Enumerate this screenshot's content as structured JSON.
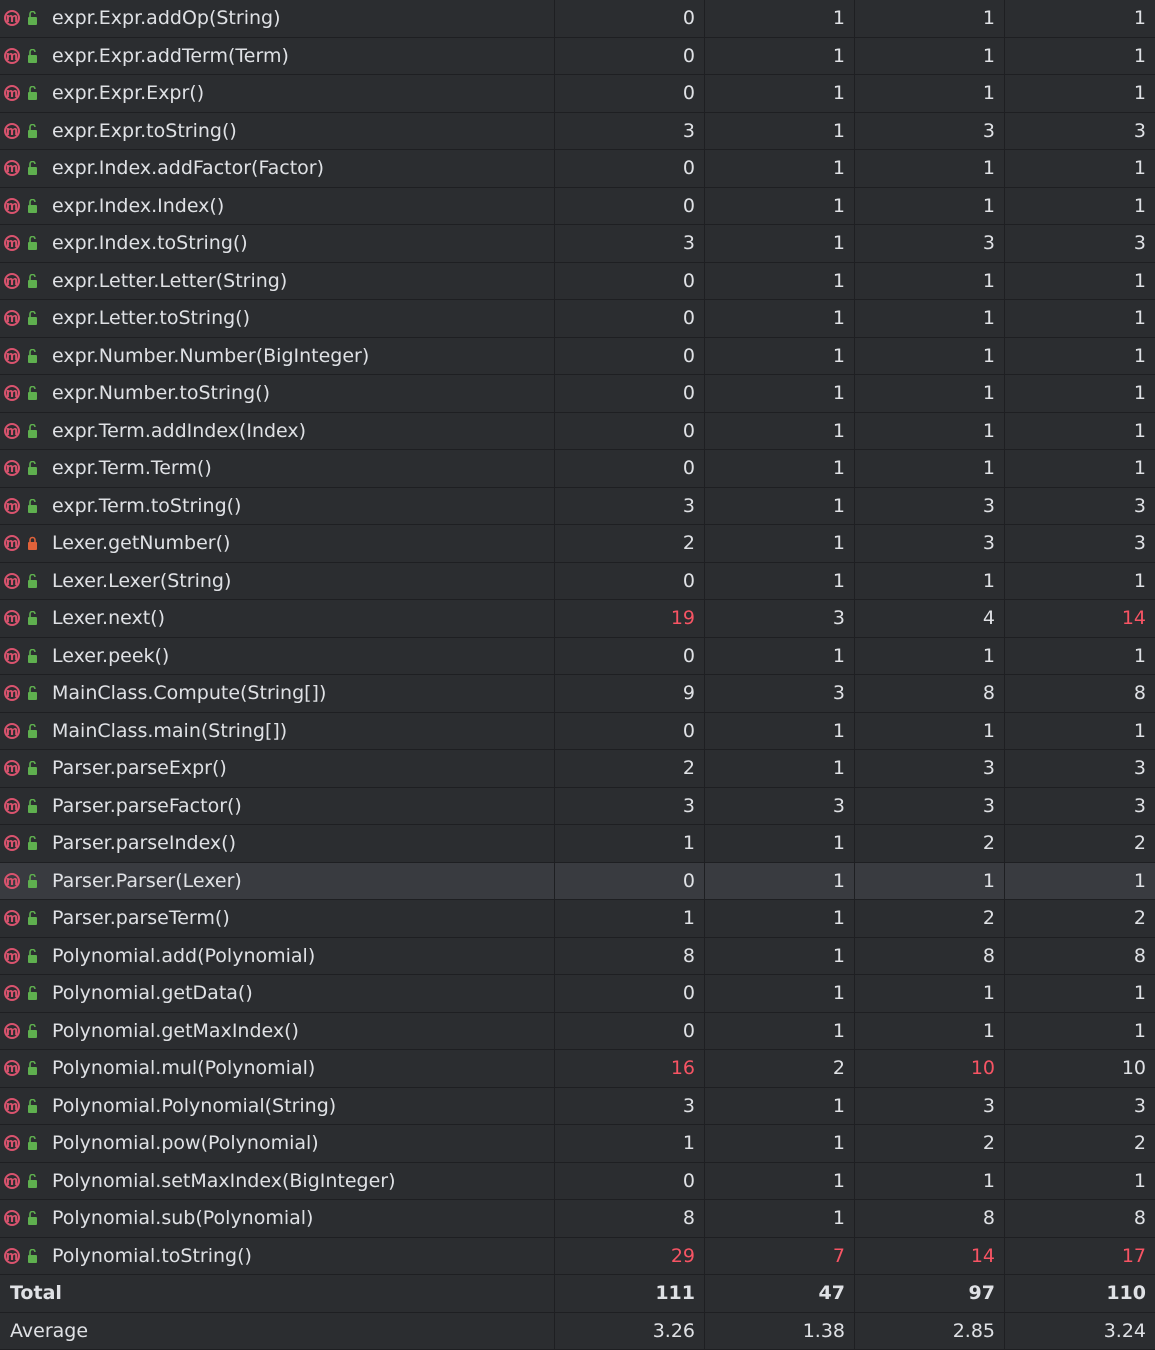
{
  "colors": {
    "background": "#2b2d30",
    "selected_row": "#393b40",
    "warning_red": "#f75464",
    "method_icon": "#d9536e",
    "public_icon": "#5fb04f",
    "private_icon": "#e0623a"
  },
  "icons": {
    "method": "method-m-icon",
    "public": "public-lock-open-icon",
    "private": "private-lock-icon"
  },
  "rows": [
    {
      "name": "expr.Expr.addOp(String)",
      "icon_letter": "m",
      "vis": "public",
      "v": [
        "0",
        "1",
        "1",
        "1"
      ],
      "red": [
        false,
        false,
        false,
        false
      ]
    },
    {
      "name": "expr.Expr.addTerm(Term)",
      "icon_letter": "m",
      "vis": "public",
      "v": [
        "0",
        "1",
        "1",
        "1"
      ],
      "red": [
        false,
        false,
        false,
        false
      ]
    },
    {
      "name": "expr.Expr.Expr()",
      "icon_letter": "m",
      "vis": "public",
      "v": [
        "0",
        "1",
        "1",
        "1"
      ],
      "red": [
        false,
        false,
        false,
        false
      ]
    },
    {
      "name": "expr.Expr.toString()",
      "icon_letter": "m",
      "vis": "public",
      "v": [
        "3",
        "1",
        "3",
        "3"
      ],
      "red": [
        false,
        false,
        false,
        false
      ]
    },
    {
      "name": "expr.Index.addFactor(Factor)",
      "icon_letter": "m",
      "vis": "public",
      "v": [
        "0",
        "1",
        "1",
        "1"
      ],
      "red": [
        false,
        false,
        false,
        false
      ]
    },
    {
      "name": "expr.Index.Index()",
      "icon_letter": "m",
      "vis": "public",
      "v": [
        "0",
        "1",
        "1",
        "1"
      ],
      "red": [
        false,
        false,
        false,
        false
      ]
    },
    {
      "name": "expr.Index.toString()",
      "icon_letter": "m",
      "vis": "public",
      "v": [
        "3",
        "1",
        "3",
        "3"
      ],
      "red": [
        false,
        false,
        false,
        false
      ]
    },
    {
      "name": "expr.Letter.Letter(String)",
      "icon_letter": "m",
      "vis": "public",
      "v": [
        "0",
        "1",
        "1",
        "1"
      ],
      "red": [
        false,
        false,
        false,
        false
      ]
    },
    {
      "name": "expr.Letter.toString()",
      "icon_letter": "m",
      "vis": "public",
      "v": [
        "0",
        "1",
        "1",
        "1"
      ],
      "red": [
        false,
        false,
        false,
        false
      ]
    },
    {
      "name": "expr.Number.Number(BigInteger)",
      "icon_letter": "m",
      "vis": "public",
      "v": [
        "0",
        "1",
        "1",
        "1"
      ],
      "red": [
        false,
        false,
        false,
        false
      ]
    },
    {
      "name": "expr.Number.toString()",
      "icon_letter": "m",
      "vis": "public",
      "v": [
        "0",
        "1",
        "1",
        "1"
      ],
      "red": [
        false,
        false,
        false,
        false
      ]
    },
    {
      "name": "expr.Term.addIndex(Index)",
      "icon_letter": "m",
      "vis": "public",
      "v": [
        "0",
        "1",
        "1",
        "1"
      ],
      "red": [
        false,
        false,
        false,
        false
      ]
    },
    {
      "name": "expr.Term.Term()",
      "icon_letter": "m",
      "vis": "public",
      "v": [
        "0",
        "1",
        "1",
        "1"
      ],
      "red": [
        false,
        false,
        false,
        false
      ]
    },
    {
      "name": "expr.Term.toString()",
      "icon_letter": "m",
      "vis": "public",
      "v": [
        "3",
        "1",
        "3",
        "3"
      ],
      "red": [
        false,
        false,
        false,
        false
      ]
    },
    {
      "name": "Lexer.getNumber()",
      "icon_letter": "m",
      "vis": "private",
      "v": [
        "2",
        "1",
        "3",
        "3"
      ],
      "red": [
        false,
        false,
        false,
        false
      ]
    },
    {
      "name": "Lexer.Lexer(String)",
      "icon_letter": "m",
      "vis": "public",
      "v": [
        "0",
        "1",
        "1",
        "1"
      ],
      "red": [
        false,
        false,
        false,
        false
      ]
    },
    {
      "name": "Lexer.next()",
      "icon_letter": "m",
      "vis": "public",
      "v": [
        "19",
        "3",
        "4",
        "14"
      ],
      "red": [
        true,
        false,
        false,
        true
      ]
    },
    {
      "name": "Lexer.peek()",
      "icon_letter": "m",
      "vis": "public",
      "v": [
        "0",
        "1",
        "1",
        "1"
      ],
      "red": [
        false,
        false,
        false,
        false
      ]
    },
    {
      "name": "MainClass.Compute(String[])",
      "icon_letter": "m",
      "vis": "public",
      "v": [
        "9",
        "3",
        "8",
        "8"
      ],
      "red": [
        false,
        false,
        false,
        false
      ]
    },
    {
      "name": "MainClass.main(String[])",
      "icon_letter": "m",
      "vis": "public",
      "v": [
        "0",
        "1",
        "1",
        "1"
      ],
      "red": [
        false,
        false,
        false,
        false
      ]
    },
    {
      "name": "Parser.parseExpr()",
      "icon_letter": "m",
      "vis": "public",
      "v": [
        "2",
        "1",
        "3",
        "3"
      ],
      "red": [
        false,
        false,
        false,
        false
      ]
    },
    {
      "name": "Parser.parseFactor()",
      "icon_letter": "m",
      "vis": "public",
      "v": [
        "3",
        "3",
        "3",
        "3"
      ],
      "red": [
        false,
        false,
        false,
        false
      ]
    },
    {
      "name": "Parser.parseIndex()",
      "icon_letter": "m",
      "vis": "public",
      "v": [
        "1",
        "1",
        "2",
        "2"
      ],
      "red": [
        false,
        false,
        false,
        false
      ]
    },
    {
      "name": "Parser.Parser(Lexer)",
      "icon_letter": "m",
      "vis": "public",
      "v": [
        "0",
        "1",
        "1",
        "1"
      ],
      "red": [
        false,
        false,
        false,
        false
      ],
      "selected": true
    },
    {
      "name": "Parser.parseTerm()",
      "icon_letter": "m",
      "vis": "public",
      "v": [
        "1",
        "1",
        "2",
        "2"
      ],
      "red": [
        false,
        false,
        false,
        false
      ]
    },
    {
      "name": "Polynomial.add(Polynomial)",
      "icon_letter": "m",
      "vis": "public",
      "v": [
        "8",
        "1",
        "8",
        "8"
      ],
      "red": [
        false,
        false,
        false,
        false
      ]
    },
    {
      "name": "Polynomial.getData()",
      "icon_letter": "m",
      "vis": "public",
      "v": [
        "0",
        "1",
        "1",
        "1"
      ],
      "red": [
        false,
        false,
        false,
        false
      ]
    },
    {
      "name": "Polynomial.getMaxIndex()",
      "icon_letter": "m",
      "vis": "public",
      "v": [
        "0",
        "1",
        "1",
        "1"
      ],
      "red": [
        false,
        false,
        false,
        false
      ]
    },
    {
      "name": "Polynomial.mul(Polynomial)",
      "icon_letter": "m",
      "vis": "public",
      "v": [
        "16",
        "2",
        "10",
        "10"
      ],
      "red": [
        true,
        false,
        true,
        false
      ]
    },
    {
      "name": "Polynomial.Polynomial(String)",
      "icon_letter": "m",
      "vis": "public",
      "v": [
        "3",
        "1",
        "3",
        "3"
      ],
      "red": [
        false,
        false,
        false,
        false
      ]
    },
    {
      "name": "Polynomial.pow(Polynomial)",
      "icon_letter": "m",
      "vis": "public",
      "v": [
        "1",
        "1",
        "2",
        "2"
      ],
      "red": [
        false,
        false,
        false,
        false
      ]
    },
    {
      "name": "Polynomial.setMaxIndex(BigInteger)",
      "icon_letter": "m",
      "vis": "public",
      "v": [
        "0",
        "1",
        "1",
        "1"
      ],
      "red": [
        false,
        false,
        false,
        false
      ]
    },
    {
      "name": "Polynomial.sub(Polynomial)",
      "icon_letter": "m",
      "vis": "public",
      "v": [
        "8",
        "1",
        "8",
        "8"
      ],
      "red": [
        false,
        false,
        false,
        false
      ]
    },
    {
      "name": "Polynomial.toString()",
      "icon_letter": "m",
      "vis": "public",
      "v": [
        "29",
        "7",
        "14",
        "17"
      ],
      "red": [
        true,
        true,
        true,
        true
      ]
    }
  ],
  "total": {
    "label": "Total",
    "v": [
      "111",
      "47",
      "97",
      "110"
    ]
  },
  "average": {
    "label": "Average",
    "v": [
      "3.26",
      "1.38",
      "2.85",
      "3.24"
    ]
  }
}
